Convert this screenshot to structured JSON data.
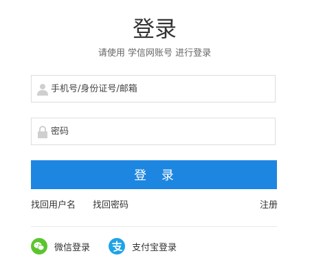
{
  "header": {
    "title": "登录",
    "subtitle": "请使用 学信网账号 进行登录"
  },
  "form": {
    "username": {
      "placeholder": "手机号/身份证号/邮箱",
      "value": "",
      "icon": "user-icon"
    },
    "password": {
      "placeholder": "密码",
      "value": "",
      "icon": "lock-icon"
    },
    "submit_label": "登 录"
  },
  "links": {
    "find_username": "找回用户名",
    "find_password": "找回密码",
    "register": "注册"
  },
  "social": {
    "wechat_label": "微信登录",
    "alipay_label": "支付宝登录"
  },
  "colors": {
    "primary": "#1d86e0",
    "wechat": "#5cc52e",
    "alipay": "#1fa3e8"
  }
}
